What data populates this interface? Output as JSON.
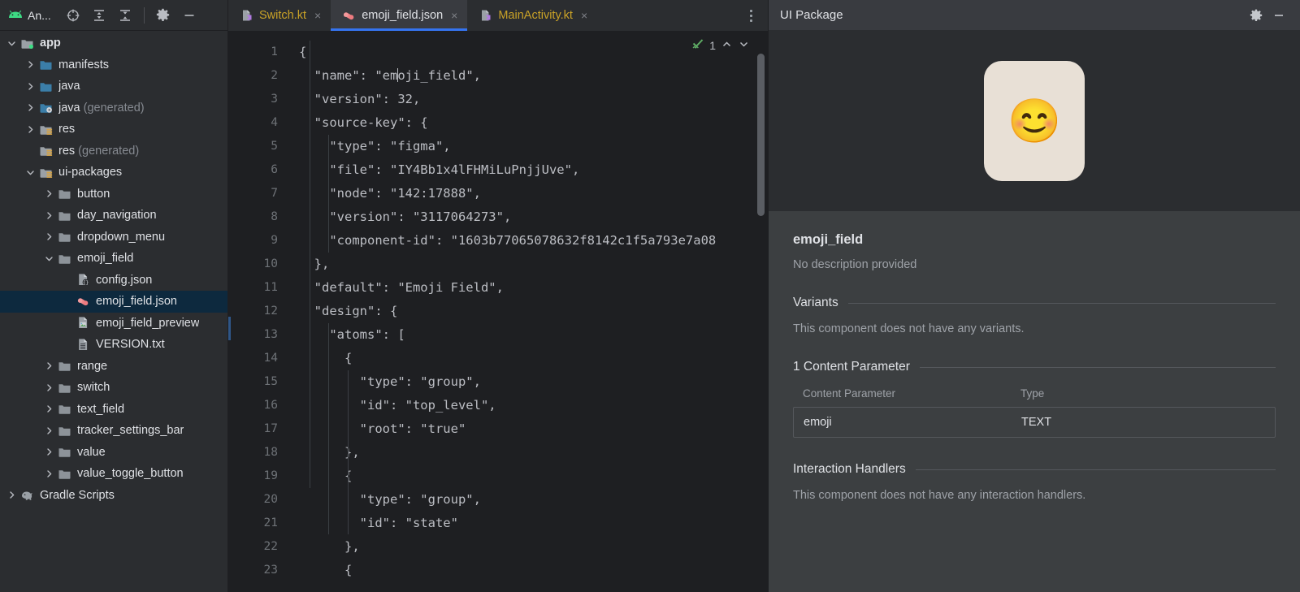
{
  "project": {
    "app_title": "An...",
    "toolbar_icons": [
      "select-opened-file-icon",
      "expand-all-icon",
      "collapse-all-icon",
      "settings-gear-icon",
      "hide-panel-icon"
    ],
    "tree": [
      {
        "label": "app",
        "suffix": "",
        "depth": 0,
        "arrow": "down",
        "icon": "module-folder-icon",
        "bold": true,
        "selected": false
      },
      {
        "label": "manifests",
        "suffix": "",
        "depth": 1,
        "arrow": "right",
        "icon": "folder-blue-icon",
        "bold": false,
        "selected": false
      },
      {
        "label": "java",
        "suffix": "",
        "depth": 1,
        "arrow": "right",
        "icon": "folder-blue-icon",
        "bold": false,
        "selected": false
      },
      {
        "label": "java",
        "suffix": " (generated)",
        "depth": 1,
        "arrow": "right",
        "icon": "folder-generated-icon",
        "bold": false,
        "selected": false
      },
      {
        "label": "res",
        "suffix": "",
        "depth": 1,
        "arrow": "right",
        "icon": "folder-res-icon",
        "bold": false,
        "selected": false
      },
      {
        "label": "res",
        "suffix": " (generated)",
        "depth": 1,
        "arrow": "none",
        "icon": "folder-res-icon",
        "bold": false,
        "selected": false
      },
      {
        "label": "ui-packages",
        "suffix": "",
        "depth": 1,
        "arrow": "down",
        "icon": "folder-res-icon",
        "bold": false,
        "selected": false
      },
      {
        "label": "button",
        "suffix": "",
        "depth": 2,
        "arrow": "right",
        "icon": "folder-gray-icon",
        "bold": false,
        "selected": false
      },
      {
        "label": "day_navigation",
        "suffix": "",
        "depth": 2,
        "arrow": "right",
        "icon": "folder-gray-icon",
        "bold": false,
        "selected": false
      },
      {
        "label": "dropdown_menu",
        "suffix": "",
        "depth": 2,
        "arrow": "right",
        "icon": "folder-gray-icon",
        "bold": false,
        "selected": false
      },
      {
        "label": "emoji_field",
        "suffix": "",
        "depth": 2,
        "arrow": "down",
        "icon": "folder-gray-icon",
        "bold": false,
        "selected": false
      },
      {
        "label": "config.json",
        "suffix": "",
        "depth": 3,
        "arrow": "none",
        "icon": "json-config-file-icon",
        "bold": false,
        "selected": false
      },
      {
        "label": "emoji_field.json",
        "suffix": "",
        "depth": 3,
        "arrow": "none",
        "icon": "ui-package-file-icon",
        "bold": false,
        "selected": true
      },
      {
        "label": "emoji_field_preview",
        "suffix": "",
        "depth": 3,
        "arrow": "none",
        "icon": "image-file-icon",
        "bold": false,
        "selected": false
      },
      {
        "label": "VERSION.txt",
        "suffix": "",
        "depth": 3,
        "arrow": "none",
        "icon": "text-file-icon",
        "bold": false,
        "selected": false
      },
      {
        "label": "range",
        "suffix": "",
        "depth": 2,
        "arrow": "right",
        "icon": "folder-gray-icon",
        "bold": false,
        "selected": false
      },
      {
        "label": "switch",
        "suffix": "",
        "depth": 2,
        "arrow": "right",
        "icon": "folder-gray-icon",
        "bold": false,
        "selected": false
      },
      {
        "label": "text_field",
        "suffix": "",
        "depth": 2,
        "arrow": "right",
        "icon": "folder-gray-icon",
        "bold": false,
        "selected": false
      },
      {
        "label": "tracker_settings_bar",
        "suffix": "",
        "depth": 2,
        "arrow": "right",
        "icon": "folder-gray-icon",
        "bold": false,
        "selected": false
      },
      {
        "label": "value",
        "suffix": "",
        "depth": 2,
        "arrow": "right",
        "icon": "folder-gray-icon",
        "bold": false,
        "selected": false
      },
      {
        "label": "value_toggle_button",
        "suffix": "",
        "depth": 2,
        "arrow": "right",
        "icon": "folder-gray-icon",
        "bold": false,
        "selected": false
      },
      {
        "label": "Gradle Scripts",
        "suffix": "",
        "depth": 0,
        "arrow": "right",
        "icon": "gradle-elephant-icon",
        "bold": false,
        "selected": false
      }
    ]
  },
  "editor": {
    "tabs": [
      {
        "label": "Switch.kt",
        "icon": "kotlin-file-icon",
        "active": false,
        "close": "×"
      },
      {
        "label": "emoji_field.json",
        "icon": "ui-package-file-icon",
        "active": true,
        "close": "×"
      },
      {
        "label": "MainActivity.kt",
        "icon": "kotlin-file-icon",
        "active": false,
        "close": "×"
      }
    ],
    "overflow_icon": "more-tabs-icon",
    "inspection": {
      "count": "1",
      "status_icon": "inspections-ok-icon",
      "up_icon": "previous-problem-icon",
      "down_icon": "next-problem-icon"
    },
    "line_numbers": [
      "1",
      "2",
      "3",
      "4",
      "5",
      "6",
      "7",
      "8",
      "9",
      "10",
      "11",
      "12",
      "13",
      "14",
      "15",
      "16",
      "17",
      "18",
      "19",
      "20",
      "21",
      "22",
      "23"
    ],
    "lines": [
      "{",
      "  \"name\": \"emoji_field\",",
      "  \"version\": 32,",
      "  \"source-key\": {",
      "    \"type\": \"figma\",",
      "    \"file\": \"IY4Bb1x4lFHMiLuPnjjUve\",",
      "    \"node\": \"142:17888\",",
      "    \"version\": \"3117064273\",",
      "    \"component-id\": \"1603b77065078632f8142c1f5a793e7a08",
      "  },",
      "  \"default\": \"Emoji Field\",",
      "  \"design\": {",
      "    \"atoms\": [",
      "      {",
      "        \"type\": \"group\",",
      "        \"id\": \"top_level\",",
      "        \"root\": \"true\"",
      "      },",
      "      {",
      "        \"type\": \"group\",",
      "        \"id\": \"state\"",
      "      },",
      "      {"
    ]
  },
  "ui_package": {
    "header_title": "UI Package",
    "header_icons": [
      "settings-gear-icon",
      "hide-panel-icon"
    ],
    "preview": {
      "emoji": "😊",
      "card_color": "#e8e0d6"
    },
    "component_name": "emoji_field",
    "description": "No description provided",
    "variants": {
      "title": "Variants",
      "body": "This component does not have any variants."
    },
    "content_parameters": {
      "title": "1 Content Parameter",
      "columns": [
        "Content Parameter",
        "Type"
      ],
      "rows": [
        {
          "name": "emoji",
          "type": "TEXT"
        }
      ]
    },
    "interaction_handlers": {
      "title": "Interaction Handlers",
      "body": "This component does not have any interaction handlers."
    }
  },
  "colors": {
    "accent": "#3574f0",
    "selection": "#0d293e",
    "kotlin_tab_text": "#c9a227"
  }
}
